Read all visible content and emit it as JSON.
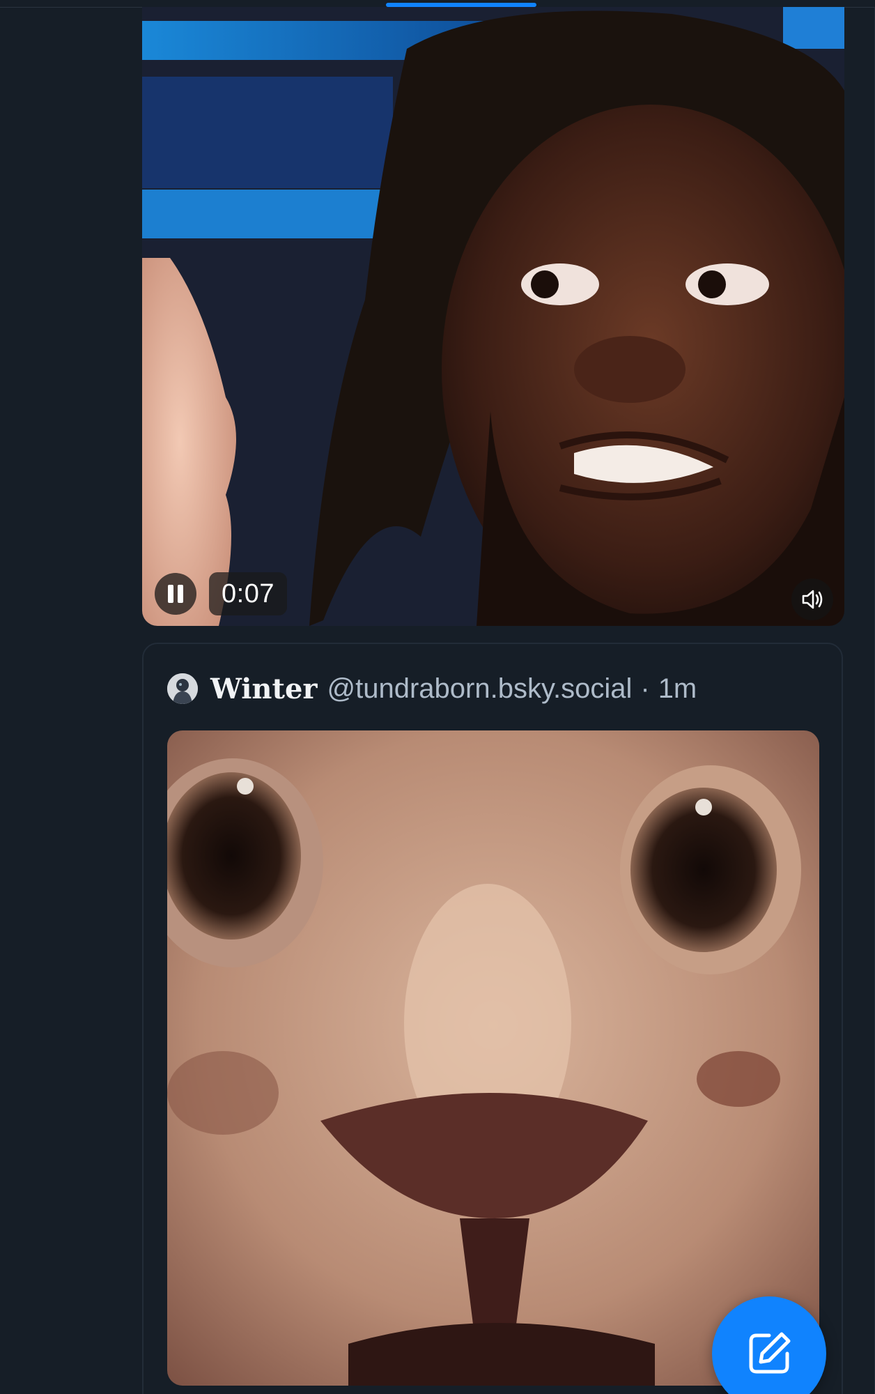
{
  "feed": {
    "video_post": {
      "media": "video",
      "playing": true,
      "time_label": "0:07",
      "controls": {
        "pause_icon": "pause-icon",
        "volume_icon": "speaker-icon"
      }
    },
    "quote_post": {
      "author_name": "Winter",
      "author_handle": "@tundraborn.bsky.social",
      "separator": "·",
      "time_ago": "1m",
      "avatar_icon": "avatar-image",
      "media": "image"
    }
  },
  "compose": {
    "icon": "compose-edit-icon"
  },
  "theme": {
    "background": "#161e27",
    "accent": "#1083fe",
    "text_primary": "#f1f3f5",
    "text_secondary": "#aebbc9"
  }
}
